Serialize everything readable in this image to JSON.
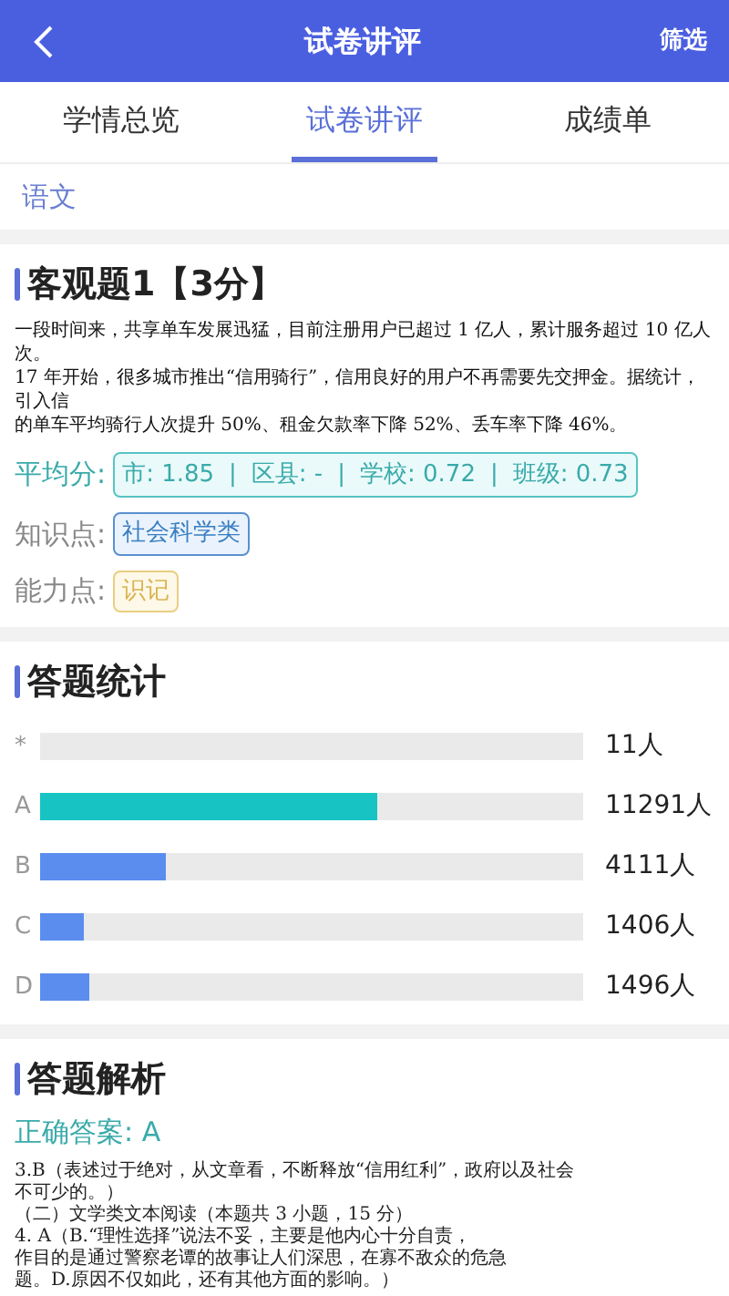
{
  "header": {
    "title": "试卷讲评",
    "action": "筛选"
  },
  "tabs": [
    {
      "label": "学情总览",
      "selected": false
    },
    {
      "label": "试卷讲评",
      "selected": true
    },
    {
      "label": "成绩单",
      "selected": false
    }
  ],
  "subject": "语文",
  "question": {
    "title": "客观题1【3分】",
    "scan_lines": [
      "一段时间来，共享单车发展迅猛，目前注册用户已超过 1 亿人，累计服务超过 10 亿人次。",
      "17 年开始，很多城市推出“信用骑行”，信用良好的用户不再需要先交押金。据统计，引入信",
      "的单车平均骑行人次提升 50%、租金欠款率下降 52%、丢车率下降 46%。"
    ],
    "average_label": "平均分:",
    "average_separator": "|",
    "averages": [
      "市: 1.85",
      "区县: -",
      "学校: 0.72",
      "班级: 0.73"
    ],
    "knowledge_label": "知识点:",
    "knowledge_tag": "社会科学类",
    "ability_label": "能力点:",
    "ability_tag": "识记"
  },
  "stats": {
    "title": "答题统计",
    "rows": [
      {
        "option": "*",
        "count": "11人"
      },
      {
        "option": "A",
        "level": 0.62,
        "count": "11291人",
        "color": "#17c3c3"
      },
      {
        "option": "B",
        "level": 0.23,
        "count": "4111人",
        "color": "#5b8def"
      },
      {
        "option": "C",
        "level": 0.08,
        "count": "1406人",
        "color": "#5b8def"
      },
      {
        "option": "D",
        "level": 0.09,
        "count": "1496人",
        "color": "#5b8def"
      }
    ]
  },
  "analysis": {
    "title": "答题解析",
    "answer": "正确答案: A",
    "scan_lines": [
      "3.B（表述过于绝对，从文章看，不断释放“信用红利”，政府以及社会",
      "不可少的。）",
      "（二）文学类文本阅读（本题共 3 小题，15 分）",
      "4. A（B.“理性选择”说法不妥，主要是他内心十分自责，",
      "作目的是通过警察老谭的故事让人们深思，在寡不敌众的危急",
      "题。D.原因不仅如此，还有其他方面的影响。）"
    ]
  }
}
